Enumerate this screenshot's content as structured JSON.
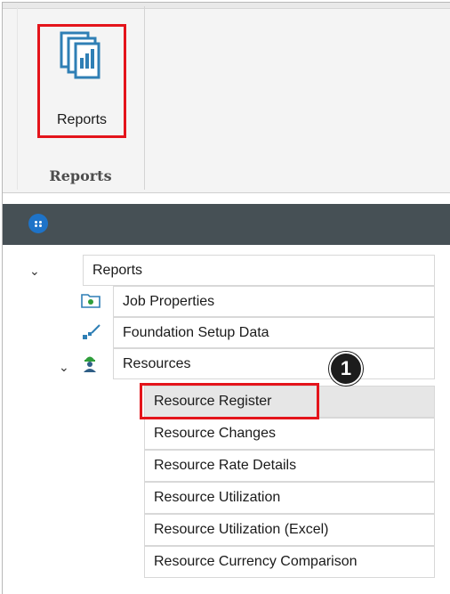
{
  "ribbon": {
    "reports_button_label": "Reports",
    "group_label": "Reports"
  },
  "tree": {
    "root_label": "Reports",
    "items": [
      {
        "label": "Job Properties",
        "icon": "job-properties-icon"
      },
      {
        "label": "Foundation Setup Data",
        "icon": "foundation-setup-icon"
      },
      {
        "label": "Resources",
        "icon": "resources-worker-icon"
      }
    ],
    "resources_children": [
      "Resource Register",
      "Resource Changes",
      "Resource Rate Details",
      "Resource Utilization",
      "Resource Utilization (Excel)",
      "Resource Currency Comparison"
    ],
    "selected_index": 0
  },
  "callout": {
    "number": "1"
  },
  "colors": {
    "highlight": "#e4141b",
    "bar": "#465055",
    "accent": "#1e73c8",
    "selected_row": "#e6e6e6"
  }
}
